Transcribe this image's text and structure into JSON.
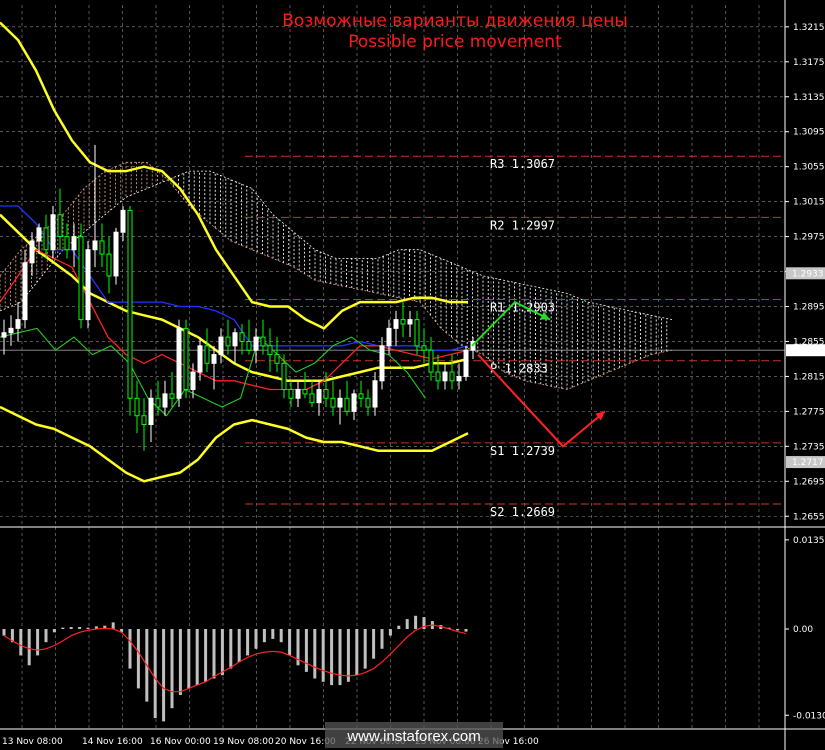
{
  "title_ru": "Возможные варианты движения цены",
  "title_en": "Possible price movement",
  "watermark": "www.instaforex.com",
  "colors": {
    "background": "#000000",
    "grid": "#8a8a8a",
    "bull": "#ffffff",
    "bear": "#00ff00",
    "bollinger": "#ffff22",
    "kijun": "#2233ff",
    "tenkan": "#ff2222",
    "chikou": "#22cc22",
    "cloud_a": "#e0a080",
    "cloud_b": "#ffffff",
    "pivot_line": "#cc3322",
    "up_arrow": "#22dd22",
    "down_arrow": "#ff2222",
    "macd_hist": "#c0c0c0",
    "macd_signal": "#ff2222"
  },
  "chart_data": {
    "type": "candlestick",
    "ylim": [
      1.2645,
      1.324
    ],
    "y_ticks": [
      "1.3215",
      "1.3175",
      "1.3135",
      "1.3095",
      "1.3055",
      "1.3015",
      "1.2975",
      "1.2935",
      "1.2895",
      "1.2855",
      "1.2815",
      "1.2775",
      "1.2735",
      "1.2695",
      "1.2655"
    ],
    "x_ticks": [
      "13 Nov 08:00",
      "14 Nov 16:00",
      "16 Nov 00:00",
      "19 Nov 08:00",
      "20 Nov 16:00",
      "22 Nov 00:00",
      "23 Nov 08:00",
      "26 Nov 16:00"
    ],
    "current_price": "1.2845",
    "marked_price": "1.2933",
    "marked_price_low": "1.2717",
    "levels": [
      {
        "name": "R3",
        "value": "1.3067"
      },
      {
        "name": "R2",
        "value": "1.2997"
      },
      {
        "name": "R1",
        "value": "1.2903"
      },
      {
        "name": "P",
        "value": "1.2833"
      },
      {
        "name": "S1",
        "value": "1.2739"
      },
      {
        "name": "S2",
        "value": "1.2669"
      }
    ],
    "candles": [
      [
        1.286,
        1.288,
        1.284,
        1.2865
      ],
      [
        1.2865,
        1.2885,
        1.285,
        1.287
      ],
      [
        1.287,
        1.29,
        1.2855,
        1.288
      ],
      [
        1.288,
        1.296,
        1.287,
        1.2945
      ],
      [
        1.2945,
        1.298,
        1.293,
        1.297
      ],
      [
        1.297,
        1.299,
        1.2955,
        1.2985
      ],
      [
        1.2985,
        1.3,
        1.295,
        1.296
      ],
      [
        1.296,
        1.301,
        1.295,
        1.3
      ],
      [
        1.3,
        1.303,
        1.296,
        1.2975
      ],
      [
        1.2975,
        1.299,
        1.295,
        1.296
      ],
      [
        1.296,
        1.299,
        1.294,
        1.2975
      ],
      [
        1.2975,
        1.299,
        1.287,
        1.288
      ],
      [
        1.288,
        1.297,
        1.287,
        1.296
      ],
      [
        1.296,
        1.308,
        1.294,
        1.297
      ],
      [
        1.297,
        1.299,
        1.294,
        1.2955
      ],
      [
        1.2955,
        1.2975,
        1.291,
        1.293
      ],
      [
        1.293,
        1.2985,
        1.292,
        1.298
      ],
      [
        1.298,
        1.301,
        1.297,
        1.3005
      ],
      [
        1.3005,
        1.301,
        1.277,
        1.279
      ],
      [
        1.279,
        1.281,
        1.275,
        1.277
      ],
      [
        1.277,
        1.279,
        1.273,
        1.276
      ],
      [
        1.276,
        1.28,
        1.274,
        1.279
      ],
      [
        1.279,
        1.281,
        1.277,
        1.278
      ],
      [
        1.278,
        1.281,
        1.277,
        1.2795
      ],
      [
        1.2795,
        1.282,
        1.278,
        1.279
      ],
      [
        1.279,
        1.288,
        1.278,
        1.287
      ],
      [
        1.287,
        1.288,
        1.279,
        1.28
      ],
      [
        1.28,
        1.283,
        1.279,
        1.282
      ],
      [
        1.282,
        1.286,
        1.281,
        1.285
      ],
      [
        1.285,
        1.287,
        1.282,
        1.283
      ],
      [
        1.283,
        1.285,
        1.28,
        1.284
      ],
      [
        1.284,
        1.287,
        1.283,
        1.286
      ],
      [
        1.286,
        1.288,
        1.284,
        1.285
      ],
      [
        1.285,
        1.287,
        1.283,
        1.2865
      ],
      [
        1.2865,
        1.2875,
        1.284,
        1.2855
      ],
      [
        1.2855,
        1.288,
        1.284,
        1.2845
      ],
      [
        1.2845,
        1.287,
        1.283,
        1.286
      ],
      [
        1.286,
        1.288,
        1.284,
        1.285
      ],
      [
        1.285,
        1.287,
        1.282,
        1.284
      ],
      [
        1.284,
        1.286,
        1.282,
        1.283
      ],
      [
        1.283,
        1.284,
        1.279,
        1.28
      ],
      [
        1.28,
        1.281,
        1.278,
        1.279
      ],
      [
        1.279,
        1.281,
        1.278,
        1.28
      ],
      [
        1.28,
        1.282,
        1.279,
        1.2795
      ],
      [
        1.2795,
        1.281,
        1.278,
        1.2785
      ],
      [
        1.2785,
        1.281,
        1.277,
        1.28
      ],
      [
        1.28,
        1.282,
        1.278,
        1.279
      ],
      [
        1.279,
        1.281,
        1.277,
        1.278
      ],
      [
        1.278,
        1.28,
        1.276,
        1.279
      ],
      [
        1.279,
        1.281,
        1.277,
        1.2775
      ],
      [
        1.2775,
        1.28,
        1.2765,
        1.2795
      ],
      [
        1.2795,
        1.281,
        1.278,
        1.279
      ],
      [
        1.279,
        1.28,
        1.277,
        1.278
      ],
      [
        1.278,
        1.282,
        1.277,
        1.281
      ],
      [
        1.281,
        1.286,
        1.28,
        1.285
      ],
      [
        1.285,
        1.288,
        1.284,
        1.287
      ],
      [
        1.287,
        1.289,
        1.285,
        1.288
      ],
      [
        1.288,
        1.29,
        1.286,
        1.2875
      ],
      [
        1.2875,
        1.289,
        1.286,
        1.288
      ],
      [
        1.288,
        1.289,
        1.284,
        1.285
      ],
      [
        1.285,
        1.287,
        1.283,
        1.2845
      ],
      [
        1.2845,
        1.286,
        1.281,
        1.282
      ],
      [
        1.282,
        1.284,
        1.28,
        1.281
      ],
      [
        1.281,
        1.283,
        1.28,
        1.282
      ],
      [
        1.282,
        1.284,
        1.28,
        1.281
      ],
      [
        1.281,
        1.283,
        1.28,
        1.2815
      ],
      [
        1.2815,
        1.285,
        1.281,
        1.2845
      ],
      [
        1.2845,
        1.286,
        1.2835,
        1.2855
      ]
    ],
    "bb_upper": [
      1.322,
      1.32,
      1.3165,
      1.312,
      1.3085,
      1.306,
      1.305,
      1.305,
      1.3055,
      1.305,
      1.303,
      1.3,
      1.296,
      1.293,
      1.29,
      1.2895,
      1.2895,
      1.288,
      1.287,
      1.289,
      1.29,
      1.29,
      1.29,
      1.2905,
      1.2905,
      1.29,
      1.29
    ],
    "bb_mid": [
      1.3,
      1.298,
      1.296,
      1.2945,
      1.293,
      1.291,
      1.29,
      1.289,
      1.2885,
      1.288,
      1.287,
      1.286,
      1.2845,
      1.283,
      1.282,
      1.2815,
      1.281,
      1.281,
      1.281,
      1.2815,
      1.282,
      1.2825,
      1.2825,
      1.2825,
      1.283,
      1.283,
      1.2835
    ],
    "bb_lower": [
      1.278,
      1.277,
      1.276,
      1.2755,
      1.2745,
      1.2735,
      1.272,
      1.2705,
      1.2695,
      1.27,
      1.2705,
      1.272,
      1.2745,
      1.276,
      1.2765,
      1.276,
      1.2755,
      1.2745,
      1.274,
      1.274,
      1.2735,
      1.273,
      1.273,
      1.273,
      1.273,
      1.274,
      1.275
    ],
    "kijun": [
      1.301,
      1.301,
      1.299,
      1.296,
      1.296,
      1.293,
      1.29,
      1.29,
      1.29,
      1.29,
      1.2895,
      1.2895,
      1.289,
      1.288,
      1.285,
      1.285,
      1.285,
      1.285,
      1.285,
      1.285,
      1.2855,
      1.285,
      1.285,
      1.285,
      1.2845,
      1.2845,
      1.285
    ],
    "tenkan": [
      1.29,
      1.293,
      1.296,
      1.295,
      1.294,
      1.29,
      1.286,
      1.284,
      1.283,
      1.284,
      1.283,
      1.282,
      1.281,
      1.281,
      1.2805,
      1.28,
      1.28,
      1.28,
      1.281,
      1.283,
      1.285,
      1.285,
      1.2845,
      1.284,
      1.2835,
      1.284,
      1.2845
    ],
    "chikou": [
      1.286,
      1.2865,
      1.287,
      1.2845,
      1.286,
      1.284,
      1.285,
      1.283,
      1.279,
      1.277,
      1.28,
      1.279,
      1.278,
      1.279,
      1.286,
      1.284,
      1.282,
      1.283,
      1.285,
      1.286,
      1.2845,
      1.284,
      1.282,
      1.279
    ],
    "span_a": [
      1.293,
      1.296,
      1.298,
      1.3,
      1.303,
      1.305,
      1.306,
      1.306,
      1.304,
      1.301,
      1.299,
      1.297,
      1.296,
      1.295,
      1.294,
      1.2925,
      1.292,
      1.2915,
      1.291,
      1.2905,
      1.29,
      1.287,
      1.285,
      1.284,
      1.282,
      1.281,
      1.2805,
      1.28,
      1.281,
      1.282,
      1.283,
      1.284,
      1.2845
    ],
    "span_b": [
      1.289,
      1.29,
      1.293,
      1.296,
      1.298,
      1.3,
      1.302,
      1.303,
      1.304,
      1.305,
      1.305,
      1.304,
      1.303,
      1.3,
      1.298,
      1.296,
      1.295,
      1.295,
      1.295,
      1.296,
      1.296,
      1.295,
      1.294,
      1.293,
      1.2925,
      1.292,
      1.2915,
      1.291,
      1.29,
      1.2895,
      1.289,
      1.2885,
      1.288
    ],
    "forecast_up": [
      1.285,
      1.29,
      1.288
    ],
    "forecast_down": [
      1.284,
      1.2735,
      1.2775
    ],
    "macd_ylim": [
      -0.015,
      0.015
    ],
    "macd_ticks": [
      "0.01351",
      "0.00",
      "-0.01307"
    ],
    "macd_hist": [
      -0.001,
      -0.002,
      -0.004,
      -0.0055,
      -0.004,
      -0.002,
      -0.0005,
      0.0002,
      0.0003,
      0.0003,
      0.0002,
      0.0004,
      0.0005,
      0.001,
      -0.0005,
      -0.006,
      -0.009,
      -0.011,
      -0.0135,
      -0.014,
      -0.012,
      -0.01,
      -0.009,
      -0.0085,
      -0.008,
      -0.0075,
      -0.007,
      -0.006,
      -0.005,
      -0.004,
      -0.003,
      -0.002,
      -0.0015,
      -0.002,
      -0.004,
      -0.0055,
      -0.0065,
      -0.0075,
      -0.008,
      -0.0085,
      -0.0085,
      -0.008,
      -0.007,
      -0.006,
      -0.0045,
      -0.003,
      -0.001,
      0.0005,
      0.0015,
      0.002,
      0.0018,
      0.0012,
      0.0006,
      0.0002,
      -0.0002,
      -0.0004
    ],
    "macd_signal": [
      -0.001,
      -0.0018,
      -0.0025,
      -0.003,
      -0.0032,
      -0.003,
      -0.0025,
      -0.0018,
      -0.001,
      -0.0005,
      -0.0002,
      0.0,
      0.0001,
      0.0,
      -0.0005,
      -0.0018,
      -0.0035,
      -0.0055,
      -0.0075,
      -0.009,
      -0.0095,
      -0.0095,
      -0.009,
      -0.0085,
      -0.008,
      -0.0072,
      -0.0065,
      -0.0058,
      -0.005,
      -0.0043,
      -0.0038,
      -0.0035,
      -0.0034,
      -0.0035,
      -0.004,
      -0.0046,
      -0.0052,
      -0.0058,
      -0.0063,
      -0.0067,
      -0.007,
      -0.0071,
      -0.007,
      -0.0066,
      -0.006,
      -0.005,
      -0.0038,
      -0.0025,
      -0.0012,
      -0.0002,
      0.0004,
      0.0006,
      0.0004,
      0.0,
      -0.0004,
      -0.0007
    ]
  }
}
